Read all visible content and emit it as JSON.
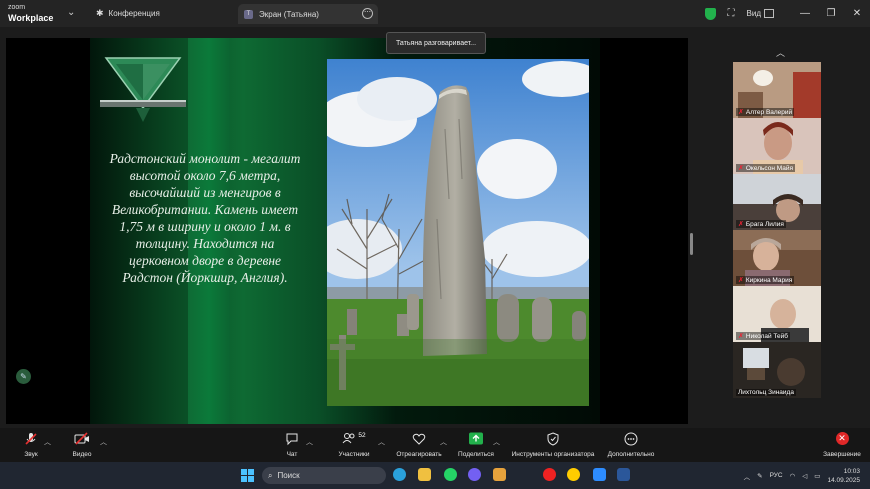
{
  "titlebar": {
    "app_line1": "zoom",
    "app_line2": "Workplace",
    "conference_label": "Конференция",
    "share_tab_label": "Экран (Татьяна)",
    "view_label": "Вид"
  },
  "status_tooltip": "Татьяна разговаривает...",
  "slide": {
    "text": "Радстонский монолит - мегалит высотой около 7,6 метра, высочайший из менгиров в Великобритании. Камень имеет 1,75 м в ширину и около 1 м. в толщину. Находится на церковном дворе в деревне Радстон (Йоркшир, Англия)."
  },
  "gallery": {
    "participants": [
      {
        "name": "Алтер Валерий",
        "muted": true
      },
      {
        "name": "Окельсон Майя",
        "muted": true
      },
      {
        "name": "Брага Лилия",
        "muted": true
      },
      {
        "name": "Киркина Мария",
        "muted": true
      },
      {
        "name": "Николай Тейб",
        "muted": true
      },
      {
        "name": "Лихтольц Зинаида",
        "muted": false
      }
    ]
  },
  "toolbar": {
    "audio_label": "Звук",
    "video_label": "Видео",
    "chat_label": "Чат",
    "participants_label": "Участники",
    "participants_count": "52",
    "react_label": "Отреагировать",
    "share_label": "Поделиться",
    "host_tools_label": "Инструменты организатора",
    "more_label": "Дополнительно",
    "end_label": "Завершение"
  },
  "taskbar": {
    "search_placeholder": "Поиск",
    "lang": "РУС",
    "time": "10:03",
    "date": "14.09.2025"
  },
  "colors": {
    "end_button": "#e02828",
    "share_active": "#22b14c",
    "muted_icon": "#ee2233"
  }
}
